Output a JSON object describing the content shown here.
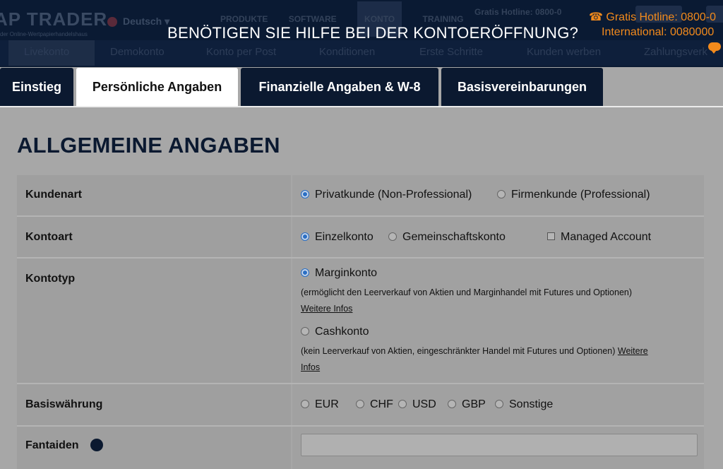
{
  "header": {
    "logo": "AP TRADER",
    "logo_sub": "der Online-Wertpapierhandelshaus",
    "language": "Deutsch",
    "topnav": [
      "PRODUKTE",
      "SOFTWARE",
      "KONTO",
      "TRAINING"
    ],
    "hotline_dim": "Gratis Hotline: 0800-0",
    "subnav": [
      "Livekonto",
      "Demokonto",
      "Konto per Post",
      "Konditionen",
      "Erste Schritte",
      "Kunden werben",
      "Zahlungsverk"
    ]
  },
  "overlay": {
    "title": "BENÖTIGEN SIE HILFE BEI DER KONTOERÖFFNUNG?",
    "hotline": "Gratis Hotline: 0800-0",
    "international": "International: 0080000"
  },
  "tabs": [
    {
      "label": "Einstieg",
      "active": false
    },
    {
      "label": "Persönliche Angaben",
      "active": true
    },
    {
      "label": "Finanzielle Angaben & W-8",
      "active": false
    },
    {
      "label": "Basisvereinbarungen",
      "active": false
    }
  ],
  "section": {
    "title": "ALLGEMEINE ANGABEN"
  },
  "form": {
    "kundenart": {
      "label": "Kundenart",
      "options": [
        {
          "label": "Privatkunde (Non-Professional)",
          "selected": true
        },
        {
          "label": "Firmenkunde (Professional)",
          "selected": false
        }
      ]
    },
    "kontoart": {
      "label": "Kontoart",
      "options": [
        {
          "label": "Einzelkonto",
          "selected": true
        },
        {
          "label": "Gemeinschaftskonto",
          "selected": false
        }
      ],
      "checkbox": {
        "label": "Managed Account",
        "checked": false
      }
    },
    "kontotyp": {
      "label": "Kontotyp",
      "margin": {
        "label": "Marginkonto",
        "selected": true,
        "note": "(ermöglicht den Leerverkauf von Aktien und Marginhandel mit Futures und Optionen)",
        "link": "Weitere Infos"
      },
      "cash": {
        "label": "Cashkonto",
        "selected": false,
        "note": "(kein Leerverkauf von Aktien, eingeschränkter Handel mit Futures und Optionen)",
        "link_part1": "Weitere",
        "link_part2": "Infos"
      }
    },
    "basiswaehrung": {
      "label": "Basiswährung",
      "options": [
        {
          "label": "EUR",
          "selected": false
        },
        {
          "label": "CHF",
          "selected": false
        },
        {
          "label": "USD",
          "selected": false
        },
        {
          "label": "GBP",
          "selected": false
        },
        {
          "label": "Sonstige",
          "selected": false
        }
      ]
    },
    "next_row": {
      "label": "Fantaiden"
    }
  },
  "colors": {
    "navy": "#0b1930",
    "accent_orange": "#f28a1c",
    "radio_selected": "#2b6fc4",
    "overlay_gray": "#a7a7a7"
  }
}
